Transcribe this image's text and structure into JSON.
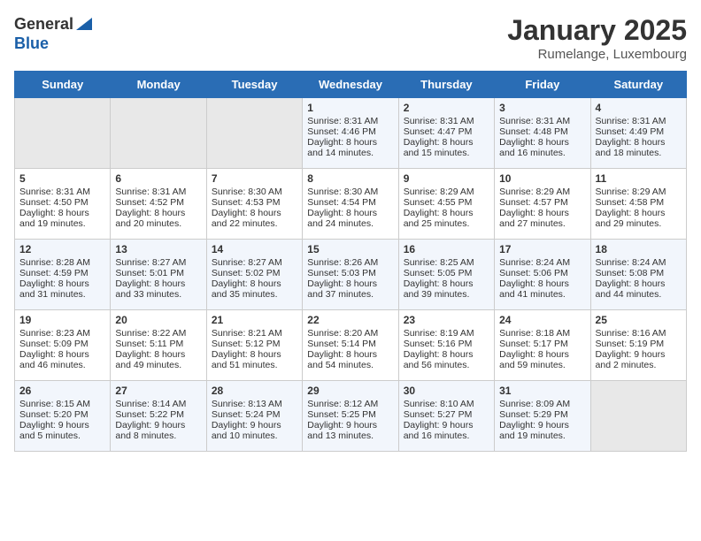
{
  "logo": {
    "general": "General",
    "blue": "Blue"
  },
  "title": "January 2025",
  "subtitle": "Rumelange, Luxembourg",
  "days_of_week": [
    "Sunday",
    "Monday",
    "Tuesday",
    "Wednesday",
    "Thursday",
    "Friday",
    "Saturday"
  ],
  "weeks": [
    [
      {
        "day": "",
        "sunrise": "",
        "sunset": "",
        "daylight": "",
        "empty": true
      },
      {
        "day": "",
        "sunrise": "",
        "sunset": "",
        "daylight": "",
        "empty": true
      },
      {
        "day": "",
        "sunrise": "",
        "sunset": "",
        "daylight": "",
        "empty": true
      },
      {
        "day": "1",
        "sunrise": "Sunrise: 8:31 AM",
        "sunset": "Sunset: 4:46 PM",
        "daylight": "Daylight: 8 hours and 14 minutes."
      },
      {
        "day": "2",
        "sunrise": "Sunrise: 8:31 AM",
        "sunset": "Sunset: 4:47 PM",
        "daylight": "Daylight: 8 hours and 15 minutes."
      },
      {
        "day": "3",
        "sunrise": "Sunrise: 8:31 AM",
        "sunset": "Sunset: 4:48 PM",
        "daylight": "Daylight: 8 hours and 16 minutes."
      },
      {
        "day": "4",
        "sunrise": "Sunrise: 8:31 AM",
        "sunset": "Sunset: 4:49 PM",
        "daylight": "Daylight: 8 hours and 18 minutes."
      }
    ],
    [
      {
        "day": "5",
        "sunrise": "Sunrise: 8:31 AM",
        "sunset": "Sunset: 4:50 PM",
        "daylight": "Daylight: 8 hours and 19 minutes."
      },
      {
        "day": "6",
        "sunrise": "Sunrise: 8:31 AM",
        "sunset": "Sunset: 4:52 PM",
        "daylight": "Daylight: 8 hours and 20 minutes."
      },
      {
        "day": "7",
        "sunrise": "Sunrise: 8:30 AM",
        "sunset": "Sunset: 4:53 PM",
        "daylight": "Daylight: 8 hours and 22 minutes."
      },
      {
        "day": "8",
        "sunrise": "Sunrise: 8:30 AM",
        "sunset": "Sunset: 4:54 PM",
        "daylight": "Daylight: 8 hours and 24 minutes."
      },
      {
        "day": "9",
        "sunrise": "Sunrise: 8:29 AM",
        "sunset": "Sunset: 4:55 PM",
        "daylight": "Daylight: 8 hours and 25 minutes."
      },
      {
        "day": "10",
        "sunrise": "Sunrise: 8:29 AM",
        "sunset": "Sunset: 4:57 PM",
        "daylight": "Daylight: 8 hours and 27 minutes."
      },
      {
        "day": "11",
        "sunrise": "Sunrise: 8:29 AM",
        "sunset": "Sunset: 4:58 PM",
        "daylight": "Daylight: 8 hours and 29 minutes."
      }
    ],
    [
      {
        "day": "12",
        "sunrise": "Sunrise: 8:28 AM",
        "sunset": "Sunset: 4:59 PM",
        "daylight": "Daylight: 8 hours and 31 minutes."
      },
      {
        "day": "13",
        "sunrise": "Sunrise: 8:27 AM",
        "sunset": "Sunset: 5:01 PM",
        "daylight": "Daylight: 8 hours and 33 minutes."
      },
      {
        "day": "14",
        "sunrise": "Sunrise: 8:27 AM",
        "sunset": "Sunset: 5:02 PM",
        "daylight": "Daylight: 8 hours and 35 minutes."
      },
      {
        "day": "15",
        "sunrise": "Sunrise: 8:26 AM",
        "sunset": "Sunset: 5:03 PM",
        "daylight": "Daylight: 8 hours and 37 minutes."
      },
      {
        "day": "16",
        "sunrise": "Sunrise: 8:25 AM",
        "sunset": "Sunset: 5:05 PM",
        "daylight": "Daylight: 8 hours and 39 minutes."
      },
      {
        "day": "17",
        "sunrise": "Sunrise: 8:24 AM",
        "sunset": "Sunset: 5:06 PM",
        "daylight": "Daylight: 8 hours and 41 minutes."
      },
      {
        "day": "18",
        "sunrise": "Sunrise: 8:24 AM",
        "sunset": "Sunset: 5:08 PM",
        "daylight": "Daylight: 8 hours and 44 minutes."
      }
    ],
    [
      {
        "day": "19",
        "sunrise": "Sunrise: 8:23 AM",
        "sunset": "Sunset: 5:09 PM",
        "daylight": "Daylight: 8 hours and 46 minutes."
      },
      {
        "day": "20",
        "sunrise": "Sunrise: 8:22 AM",
        "sunset": "Sunset: 5:11 PM",
        "daylight": "Daylight: 8 hours and 49 minutes."
      },
      {
        "day": "21",
        "sunrise": "Sunrise: 8:21 AM",
        "sunset": "Sunset: 5:12 PM",
        "daylight": "Daylight: 8 hours and 51 minutes."
      },
      {
        "day": "22",
        "sunrise": "Sunrise: 8:20 AM",
        "sunset": "Sunset: 5:14 PM",
        "daylight": "Daylight: 8 hours and 54 minutes."
      },
      {
        "day": "23",
        "sunrise": "Sunrise: 8:19 AM",
        "sunset": "Sunset: 5:16 PM",
        "daylight": "Daylight: 8 hours and 56 minutes."
      },
      {
        "day": "24",
        "sunrise": "Sunrise: 8:18 AM",
        "sunset": "Sunset: 5:17 PM",
        "daylight": "Daylight: 8 hours and 59 minutes."
      },
      {
        "day": "25",
        "sunrise": "Sunrise: 8:16 AM",
        "sunset": "Sunset: 5:19 PM",
        "daylight": "Daylight: 9 hours and 2 minutes."
      }
    ],
    [
      {
        "day": "26",
        "sunrise": "Sunrise: 8:15 AM",
        "sunset": "Sunset: 5:20 PM",
        "daylight": "Daylight: 9 hours and 5 minutes."
      },
      {
        "day": "27",
        "sunrise": "Sunrise: 8:14 AM",
        "sunset": "Sunset: 5:22 PM",
        "daylight": "Daylight: 9 hours and 8 minutes."
      },
      {
        "day": "28",
        "sunrise": "Sunrise: 8:13 AM",
        "sunset": "Sunset: 5:24 PM",
        "daylight": "Daylight: 9 hours and 10 minutes."
      },
      {
        "day": "29",
        "sunrise": "Sunrise: 8:12 AM",
        "sunset": "Sunset: 5:25 PM",
        "daylight": "Daylight: 9 hours and 13 minutes."
      },
      {
        "day": "30",
        "sunrise": "Sunrise: 8:10 AM",
        "sunset": "Sunset: 5:27 PM",
        "daylight": "Daylight: 9 hours and 16 minutes."
      },
      {
        "day": "31",
        "sunrise": "Sunrise: 8:09 AM",
        "sunset": "Sunset: 5:29 PM",
        "daylight": "Daylight: 9 hours and 19 minutes."
      },
      {
        "day": "",
        "sunrise": "",
        "sunset": "",
        "daylight": "",
        "empty": true
      }
    ]
  ]
}
